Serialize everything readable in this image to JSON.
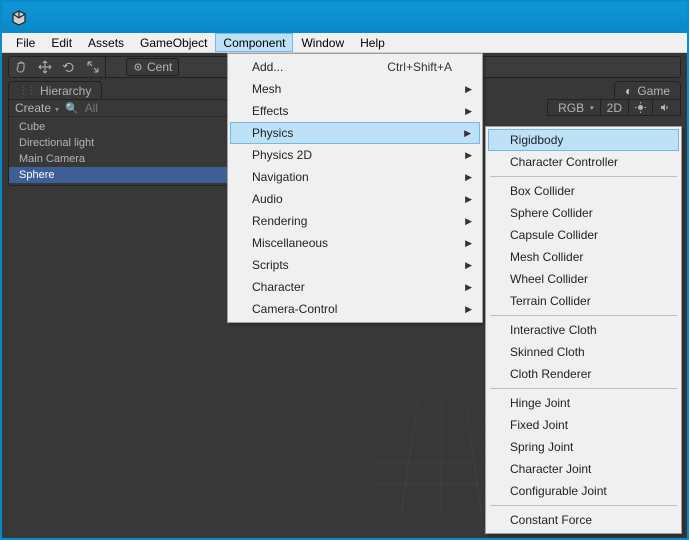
{
  "menubar": {
    "items": [
      "File",
      "Edit",
      "Assets",
      "GameObject",
      "Component",
      "Window",
      "Help"
    ],
    "open_index": 4
  },
  "toolbar": {
    "pivot_label": "Cent"
  },
  "hierarchy": {
    "title": "Hierarchy",
    "create_label": "Create",
    "search_placeholder": "All",
    "items": [
      "Cube",
      "Directional light",
      "Main Camera",
      "Sphere"
    ],
    "selected_index": 3
  },
  "game": {
    "title": "Game",
    "bar": {
      "rgb": "RGB",
      "mode2d": "2D"
    }
  },
  "component_menu": {
    "items": [
      {
        "label": "Add...",
        "shortcut": "Ctrl+Shift+A"
      },
      {
        "label": "Mesh",
        "submenu": true
      },
      {
        "label": "Effects",
        "submenu": true
      },
      {
        "label": "Physics",
        "submenu": true,
        "highlight": true
      },
      {
        "label": "Physics 2D",
        "submenu": true
      },
      {
        "label": "Navigation",
        "submenu": true
      },
      {
        "label": "Audio",
        "submenu": true
      },
      {
        "label": "Rendering",
        "submenu": true
      },
      {
        "label": "Miscellaneous",
        "submenu": true
      },
      {
        "label": "Scripts",
        "submenu": true
      },
      {
        "label": "Character",
        "submenu": true
      },
      {
        "label": "Camera-Control",
        "submenu": true
      }
    ]
  },
  "physics_menu": {
    "groups": [
      [
        "Rigidbody",
        "Character Controller"
      ],
      [
        "Box Collider",
        "Sphere Collider",
        "Capsule Collider",
        "Mesh Collider",
        "Wheel Collider",
        "Terrain Collider"
      ],
      [
        "Interactive Cloth",
        "Skinned Cloth",
        "Cloth Renderer"
      ],
      [
        "Hinge Joint",
        "Fixed Joint",
        "Spring Joint",
        "Character Joint",
        "Configurable Joint"
      ],
      [
        "Constant Force"
      ]
    ],
    "highlight": "Rigidbody"
  }
}
